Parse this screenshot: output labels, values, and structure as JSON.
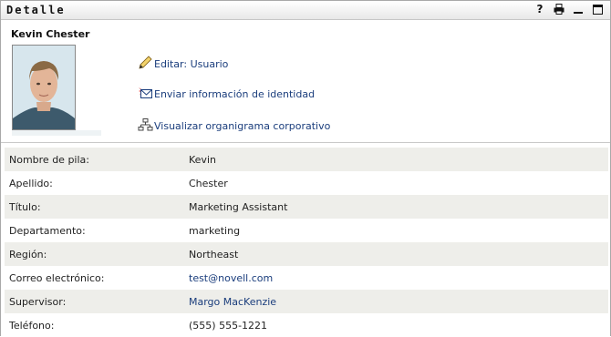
{
  "panel": {
    "title": "Detalle",
    "help_glyph": "?",
    "icons": [
      "help-icon",
      "print-icon",
      "minimize-icon",
      "maximize-icon"
    ]
  },
  "person": {
    "name": "Kevin Chester"
  },
  "actions": [
    {
      "label": "Editar: Usuario",
      "icon": "pencil-icon"
    },
    {
      "label": "Enviar información de identidad",
      "icon": "envelope-icon"
    },
    {
      "label": "Visualizar organigrama corporativo",
      "icon": "org-chart-icon"
    }
  ],
  "fields": [
    {
      "label": "Nombre de pila:",
      "value": "Kevin",
      "link": false
    },
    {
      "label": "Apellido:",
      "value": "Chester",
      "link": false
    },
    {
      "label": "Título:",
      "value": "Marketing Assistant",
      "link": false
    },
    {
      "label": "Departamento:",
      "value": "marketing",
      "link": false
    },
    {
      "label": "Región:",
      "value": "Northeast",
      "link": false
    },
    {
      "label": "Correo electrónico:",
      "value": "test@novell.com",
      "link": true
    },
    {
      "label": "Supervisor:",
      "value": "Margo MacKenzie",
      "link": true
    },
    {
      "label": "Teléfono:",
      "value": "(555) 555-1221",
      "link": false
    }
  ],
  "colors": {
    "link": "#1a3d7c",
    "row_stripe": "#eeeeea"
  }
}
